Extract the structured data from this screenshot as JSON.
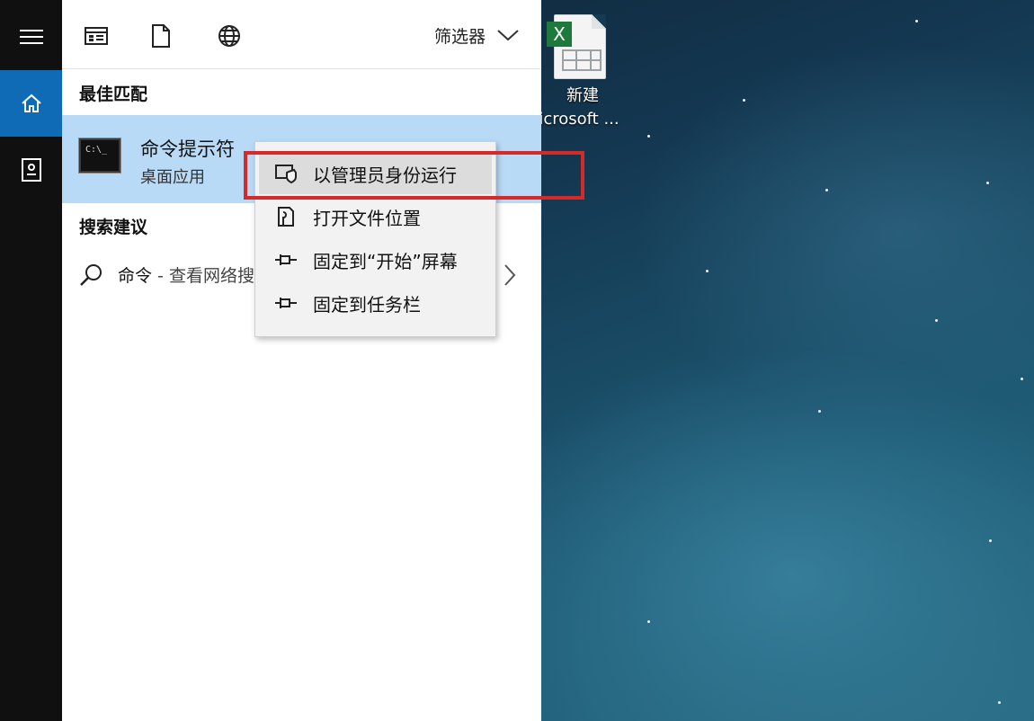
{
  "desktop": {
    "icon": {
      "name": "excel-file-icon",
      "badge": "X",
      "caption_line1": "新建",
      "caption_line2": "icrosoft ..."
    }
  },
  "rail": {
    "items": [
      {
        "name": "hamburger-menu-icon"
      },
      {
        "name": "home-icon",
        "selected": true
      },
      {
        "name": "documents-icon"
      }
    ]
  },
  "toolbar": {
    "icons": [
      "apps-icon",
      "document-icon",
      "web-icon"
    ],
    "filter_label": "筛选器"
  },
  "best_match": {
    "title": "最佳匹配",
    "app_name": "命令提示符",
    "app_type": "桌面应用",
    "icon_text": "C:\\_"
  },
  "suggestions": {
    "title": "搜索建议",
    "items": [
      {
        "query": "命令",
        "separator": " - ",
        "hint": "查看网络搜"
      }
    ]
  },
  "context_menu": {
    "items": [
      {
        "label": "以管理员身份运行",
        "icon": "admin-shield-icon",
        "highlighted": true
      },
      {
        "label": "打开文件位置",
        "icon": "folder-location-icon"
      },
      {
        "label": "固定到“开始”屏幕",
        "icon": "pin-icon"
      },
      {
        "label": "固定到任务栏",
        "icon": "pin-icon"
      }
    ]
  },
  "colors": {
    "accent": "#0f6bb6",
    "selection": "#b9daf6",
    "annotation": "#d42a2a"
  }
}
